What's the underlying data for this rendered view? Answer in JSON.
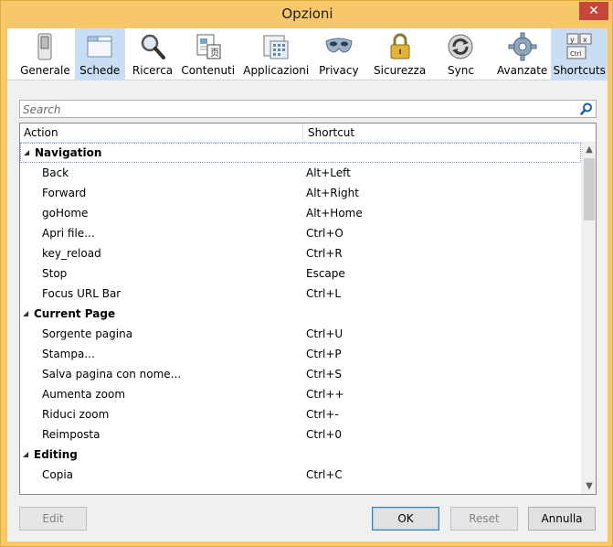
{
  "window": {
    "title": "Opzioni",
    "close_label": "✕"
  },
  "toolbar": {
    "items": [
      {
        "label": "Generale",
        "icon": "switch-icon"
      },
      {
        "label": "Schede",
        "icon": "tabs-window-icon",
        "selected": true
      },
      {
        "label": "Ricerca",
        "icon": "magnifier-icon"
      },
      {
        "label": "Contenuti",
        "icon": "content-page-icon"
      },
      {
        "label": "Applicazioni",
        "icon": "applications-icon"
      },
      {
        "label": "Privacy",
        "icon": "mask-icon"
      },
      {
        "label": "Sicurezza",
        "icon": "padlock-icon"
      },
      {
        "label": "Sync",
        "icon": "sync-icon"
      },
      {
        "label": "Avanzate",
        "icon": "gear-icon"
      },
      {
        "label": "Shortcuts",
        "icon": "keyboard-keys-icon",
        "selected": true
      }
    ]
  },
  "search": {
    "placeholder": "Search"
  },
  "columns": {
    "action": "Action",
    "shortcut": "Shortcut"
  },
  "groups": [
    {
      "name": "Navigation",
      "items": [
        {
          "action": "Back",
          "shortcut": "Alt+Left"
        },
        {
          "action": "Forward",
          "shortcut": "Alt+Right"
        },
        {
          "action": "goHome",
          "shortcut": "Alt+Home"
        },
        {
          "action": "Apri file...",
          "shortcut": "Ctrl+O"
        },
        {
          "action": "key_reload",
          "shortcut": "Ctrl+R"
        },
        {
          "action": "Stop",
          "shortcut": "Escape"
        },
        {
          "action": "Focus URL Bar",
          "shortcut": "Ctrl+L"
        }
      ]
    },
    {
      "name": "Current Page",
      "items": [
        {
          "action": "Sorgente pagina",
          "shortcut": "Ctrl+U"
        },
        {
          "action": "Stampa...",
          "shortcut": "Ctrl+P"
        },
        {
          "action": "Salva pagina con nome...",
          "shortcut": "Ctrl+S"
        },
        {
          "action": "Aumenta zoom",
          "shortcut": "Ctrl++"
        },
        {
          "action": "Riduci zoom",
          "shortcut": "Ctrl+-"
        },
        {
          "action": "Reimposta",
          "shortcut": "Ctrl+0"
        }
      ]
    },
    {
      "name": "Editing",
      "items": [
        {
          "action": "Copia",
          "shortcut": "Ctrl+C"
        }
      ]
    }
  ],
  "buttons": {
    "edit": "Edit",
    "ok": "OK",
    "reset": "Reset",
    "cancel": "Annulla"
  },
  "colors": {
    "frame": "#f6c86a",
    "selected_tab": "#c9ddf3",
    "close": "#c7463a"
  }
}
